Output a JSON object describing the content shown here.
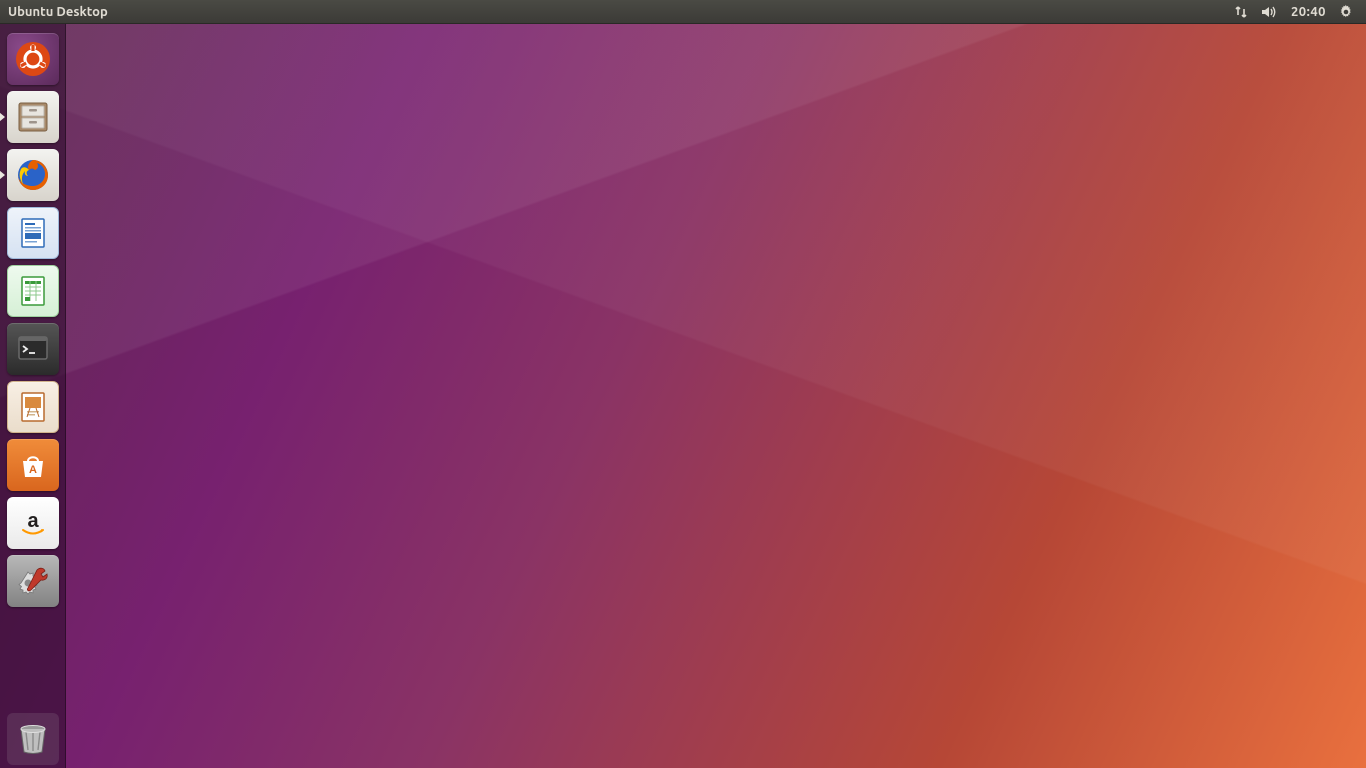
{
  "topbar": {
    "title": "Ubuntu Desktop",
    "clock": "20:40",
    "indicators": {
      "network": "network-icon",
      "sound": "volume-icon",
      "session": "power-cog-icon"
    }
  },
  "launcher": {
    "items": [
      {
        "name": "dash",
        "label": "Dash",
        "tile": "tile-purple",
        "running": false
      },
      {
        "name": "files",
        "label": "Files",
        "tile": "tile-gray",
        "running": true
      },
      {
        "name": "firefox",
        "label": "Firefox",
        "tile": "tile-gray",
        "running": true
      },
      {
        "name": "writer",
        "label": "LibreOffice Writer",
        "tile": "tile-blue",
        "running": false
      },
      {
        "name": "calc",
        "label": "LibreOffice Calc",
        "tile": "tile-green",
        "running": false
      },
      {
        "name": "terminal",
        "label": "Terminal",
        "tile": "tile-dark",
        "running": false
      },
      {
        "name": "impress",
        "label": "LibreOffice Impress",
        "tile": "tile-brown",
        "running": false
      },
      {
        "name": "software",
        "label": "Ubuntu Software",
        "tile": "tile-orange",
        "running": false
      },
      {
        "name": "amazon",
        "label": "Amazon",
        "tile": "tile-white",
        "running": false
      },
      {
        "name": "settings",
        "label": "System Settings",
        "tile": "tile-steel",
        "running": false
      }
    ],
    "trash": {
      "name": "trash",
      "label": "Trash"
    }
  }
}
